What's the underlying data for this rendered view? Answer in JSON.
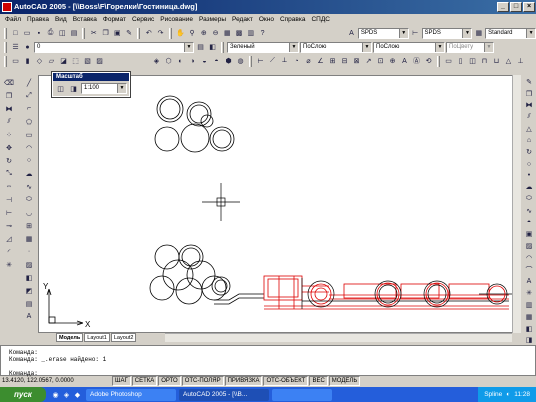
{
  "window": {
    "title": "AutoCAD 2005 - [\\\\Boss\\F\\Горелки\\Гостиница.dwg]"
  },
  "menu": [
    "Файл",
    "Правка",
    "Вид",
    "Вставка",
    "Формат",
    "Сервис",
    "Рисование",
    "Размеры",
    "Редакт",
    "Окно",
    "Справка",
    "СПДС"
  ],
  "toolbar1": {
    "style1": "SPDS",
    "style2": "SPDS",
    "style3": "Standard"
  },
  "toolbar2": {
    "layer": "0",
    "color": "Зеленый",
    "linetype": "ПоСлою",
    "lineweight": "ПоСлою",
    "plotstyle": "ПоЦвету"
  },
  "palette": {
    "title": "Масштаб",
    "scale": "1:100"
  },
  "tabs": [
    "Модель",
    "Layout1",
    "Layout2"
  ],
  "command": {
    "lines": [
      "Команда:",
      "Команда: _.erase найдено: 1",
      "",
      "Команда:"
    ]
  },
  "status": {
    "coords": "13.4120, 122.0567, 0.0000",
    "buttons": [
      "ШАГ",
      "СЕТКА",
      "ОРТО",
      "ОТС-ПОЛЯР",
      "ПРИВЯЗКА",
      "ОТС-ОБЪЕКТ",
      "ВЕС",
      "МОДЕЛЬ"
    ]
  },
  "taskbar": {
    "start": "пуск",
    "tasks": [
      "Adobe Photoshop",
      "AutoCAD 2005 - [\\\\B...",
      ""
    ],
    "tray_text": "Spline",
    "clock": "11:28"
  },
  "ucs": {
    "x": "X",
    "y": "Y"
  }
}
